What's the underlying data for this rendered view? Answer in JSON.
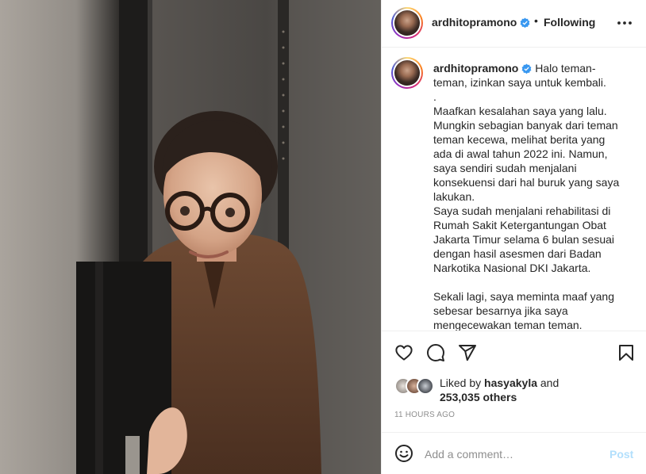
{
  "post": {
    "username": "ardhitopramono",
    "separator": "•",
    "following_label": "Following",
    "more_icon": "more-horizontal-icon",
    "verified_icon": "verified-badge-icon",
    "caption": {
      "username": "ardhitopramono",
      "text": " Halo teman-teman, izinkan saya untuk kembali.\n.\nMaafkan kesalahan saya yang lalu. Mungkin sebagian banyak dari teman teman kecewa, melihat berita yang ada di awal tahun 2022 ini. Namun, saya sendiri sudah menjalani konsekuensi dari hal buruk yang saya lakukan.\nSaya sudah menjalani rehabilitasi di Rumah Sakit Ketergantungan Obat Jakarta Timur selama 6 bulan sesuai dengan hasil asesmen dari Badan Narkotika Nasional DKI Jakarta.\n\nSekali lagi, saya meminta maaf yang sebesar besarnya jika saya mengecewakan teman teman."
    },
    "actions": {
      "like_icon": "heart-icon",
      "comment_icon": "comment-icon",
      "share_icon": "send-icon",
      "save_icon": "bookmark-icon"
    },
    "likes": {
      "prefix": "Liked by",
      "user": "hasyakyla",
      "conj": "and",
      "others": "253,035 others"
    },
    "timestamp": "11 HOURS AGO",
    "add_comment": {
      "placeholder": "Add a comment…",
      "post_label": "Post",
      "emoji_icon": "emoji-icon"
    }
  },
  "colors": {
    "verified": "#3897f0",
    "post_button_disabled": "#b2dffc",
    "muted": "#8e8e8e"
  }
}
